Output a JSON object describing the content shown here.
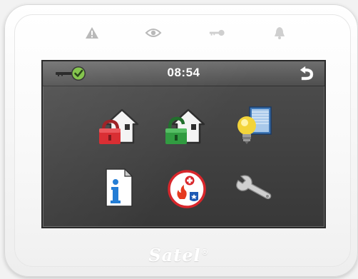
{
  "keypad": {
    "indicators": [
      {
        "name": "trouble-icon",
        "color": "#b5b5b5"
      },
      {
        "name": "eye-icon",
        "color": "#b5b5b5"
      },
      {
        "name": "key-icon",
        "color": "#d0d0d0"
      },
      {
        "name": "bell-icon",
        "color": "#d0d0d0"
      }
    ],
    "brand": "Satel",
    "brand_mark": "®"
  },
  "screen": {
    "status_bar": {
      "time": "08:54",
      "left_icon": "key-check-icon",
      "right_icon": "back-arrow-icon"
    },
    "tiles": [
      {
        "name": "arm-icon",
        "color": "#d8262b"
      },
      {
        "name": "disarm-icon",
        "color": "#2e9a3e"
      },
      {
        "name": "lighting-control-icon",
        "color": "#f3d43a"
      },
      {
        "name": "info-icon",
        "color": "#1f7ad4"
      },
      {
        "name": "alarm-icon",
        "color": "#d8262b"
      },
      {
        "name": "service-wrench-icon",
        "color": "#d0d0d0"
      }
    ],
    "colors": {
      "background": "#404040",
      "text": "#ffffff"
    }
  }
}
